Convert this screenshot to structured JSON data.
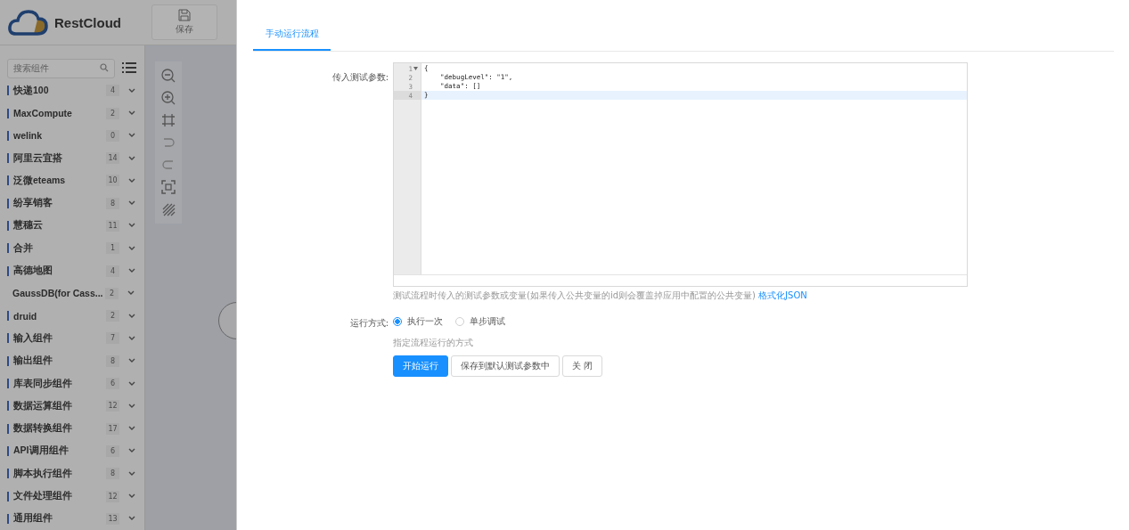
{
  "header": {
    "logo_text": "RestCloud",
    "save_button": "保存"
  },
  "sidebar": {
    "search": {
      "placeholder": "搜索组件"
    },
    "groups": [
      {
        "name": "快递100",
        "count": "4",
        "marker": true
      },
      {
        "name": "MaxCompute",
        "count": "2",
        "marker": true
      },
      {
        "name": "welink",
        "count": "0",
        "marker": true
      },
      {
        "name": "阿里云宜搭",
        "count": "14",
        "marker": true
      },
      {
        "name": "泛微eteams",
        "count": "10",
        "marker": true
      },
      {
        "name": "纷享销客",
        "count": "8",
        "marker": true
      },
      {
        "name": "慧穗云",
        "count": "11",
        "marker": true
      },
      {
        "name": "合并",
        "count": "1",
        "marker": true
      },
      {
        "name": "高德地图",
        "count": "4",
        "marker": true
      },
      {
        "name": "GaussDB(for Cass...",
        "count": "2",
        "marker": false
      },
      {
        "name": "druid",
        "count": "2",
        "marker": true
      },
      {
        "name": "输入组件",
        "count": "7",
        "marker": true
      },
      {
        "name": "输出组件",
        "count": "8",
        "marker": true
      },
      {
        "name": "库表同步组件",
        "count": "6",
        "marker": true
      },
      {
        "name": "数据运算组件",
        "count": "12",
        "marker": true
      },
      {
        "name": "数据转换组件",
        "count": "17",
        "marker": true
      },
      {
        "name": "API调用组件",
        "count": "6",
        "marker": true
      },
      {
        "name": "脚本执行组件",
        "count": "8",
        "marker": true
      },
      {
        "name": "文件处理组件",
        "count": "12",
        "marker": true
      },
      {
        "name": "通用组件",
        "count": "13",
        "marker": true
      }
    ]
  },
  "drawer": {
    "tabs": [
      {
        "label": "手动运行流程",
        "selected": true
      }
    ],
    "params": {
      "label": "传入测试参数:",
      "lines": [
        {
          "number": "1",
          "text": "{",
          "foldable": true,
          "current": false
        },
        {
          "number": "2",
          "text": "    \"debugLevel\": \"1\",",
          "foldable": false,
          "current": false
        },
        {
          "number": "3",
          "text": "    \"data\": []",
          "foldable": false,
          "current": false
        },
        {
          "number": "4",
          "text": "}",
          "foldable": false,
          "current": true
        }
      ],
      "hint": "测试流程时传入的测试参数或变量(如果传入公共变量的id则会覆盖掉应用中配置的公共变量)",
      "hint_link": "格式化JSON"
    },
    "run_mode": {
      "label": "运行方式:",
      "options": [
        {
          "label": "执行一次",
          "selected": true
        },
        {
          "label": "单步调试",
          "selected": false
        }
      ],
      "hint": "指定流程运行的方式"
    },
    "buttons": [
      {
        "label": "开始运行",
        "kind": "primary"
      },
      {
        "label": "保存到默认测试参数中",
        "kind": "default"
      },
      {
        "label": "关 闭",
        "kind": "default"
      }
    ]
  }
}
